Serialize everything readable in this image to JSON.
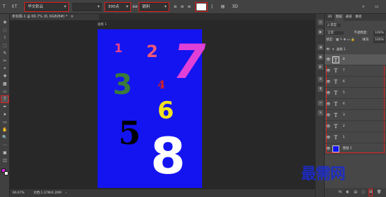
{
  "options_bar": {
    "tool_icon": "T",
    "orient_icon": "↕T",
    "font_family": "华文彩云",
    "font_style": "",
    "size_icon": "T",
    "font_size": "300点",
    "aa_icon": "aa",
    "aa_mode": "锐利",
    "color_swatch": "#ffffff",
    "mode_3d": "3D"
  },
  "document_tab": {
    "title": "未标题-1 @ 66.7% (8, RGB/8#) *",
    "close": "×"
  },
  "canvas": {
    "label": "画板 1",
    "background": "#1414f0",
    "numbers": [
      {
        "text": "1",
        "color": "#e8408c"
      },
      {
        "text": "2",
        "color": "#f05878"
      },
      {
        "text": "7",
        "color": "#e040d8"
      },
      {
        "text": "3",
        "color": "#3a7a3a"
      },
      {
        "text": "4",
        "color": "#d82020"
      },
      {
        "text": "6",
        "color": "#f0e020"
      },
      {
        "text": "5",
        "color": "#000000"
      },
      {
        "text": "8",
        "color": "#ffffff"
      }
    ]
  },
  "status": {
    "zoom": "66.67%",
    "doc": "文档:1.37M/4.20M",
    "arrow": "›"
  },
  "toolbar": {
    "tools": [
      "✥",
      "◌",
      "⌇",
      "⬚",
      "✎",
      "✂",
      "⌖",
      "✚",
      "▩",
      "▭",
      "T",
      "✒",
      "➤",
      "▭",
      "✋",
      "🔍",
      "⋯",
      "▣",
      "◫"
    ]
  },
  "layers_panel": {
    "tabs": [
      "3D",
      "图层",
      "通道",
      "路径"
    ],
    "kind_label": "ρ 类型",
    "blend_mode": "正常",
    "opacity_label": "不透明度:",
    "opacity": "100%",
    "lock_label": "锁定:",
    "fill_label": "填充:",
    "fill": "100%",
    "artboard": "画板 1",
    "layers": [
      {
        "name": "8"
      },
      {
        "name": "7"
      },
      {
        "name": "6"
      },
      {
        "name": "5"
      },
      {
        "name": "4"
      },
      {
        "name": "3"
      },
      {
        "name": "2"
      },
      {
        "name": "1"
      },
      {
        "name": "图层 1"
      }
    ],
    "bottom_icons": [
      "fx",
      "◐",
      "▤",
      "▢",
      "⊞",
      "🗑"
    ]
  },
  "watermark": "最需网"
}
